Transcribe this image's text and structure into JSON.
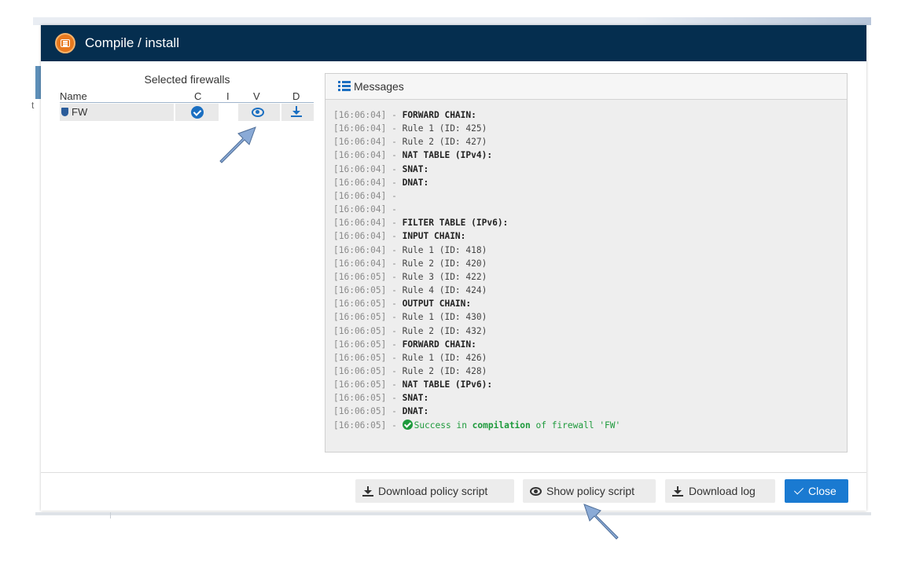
{
  "modal": {
    "title": "Compile / install",
    "header_icon": "compile-icon",
    "header_color": "#052e4f",
    "accent_color": "#1a7ad1"
  },
  "firewalls": {
    "caption": "Selected firewalls",
    "columns": [
      "Name",
      "C",
      "I",
      "V",
      "D"
    ],
    "rows": [
      {
        "name": "FW",
        "icon": "firewall-shield-icon",
        "compiled": "check-circle-icon",
        "installed": "",
        "view": "eye-icon",
        "download": "download-icon"
      }
    ]
  },
  "messages": {
    "title": "Messages",
    "icon": "list-icon",
    "log": [
      {
        "time": "[16:06:04]",
        "text": "FORWARD CHAIN:",
        "bold": true
      },
      {
        "time": "[16:06:04]",
        "text": "Rule 1 (ID: 425)",
        "bold": false
      },
      {
        "time": "[16:06:04]",
        "text": "Rule 2 (ID: 427)",
        "bold": false
      },
      {
        "time": "[16:06:04]",
        "text": "NAT TABLE (IPv4):",
        "bold": true
      },
      {
        "time": "[16:06:04]",
        "text": "SNAT:",
        "bold": true
      },
      {
        "time": "[16:06:04]",
        "text": "DNAT:",
        "bold": true
      },
      {
        "time": "[16:06:04]",
        "text": "",
        "bold": false
      },
      {
        "time": "[16:06:04]",
        "text": "",
        "bold": false
      },
      {
        "time": "[16:06:04]",
        "text": "FILTER TABLE (IPv6):",
        "bold": true
      },
      {
        "time": "[16:06:04]",
        "text": "INPUT CHAIN:",
        "bold": true
      },
      {
        "time": "[16:06:04]",
        "text": "Rule 1 (ID: 418)",
        "bold": false
      },
      {
        "time": "[16:06:04]",
        "text": "Rule 2 (ID: 420)",
        "bold": false
      },
      {
        "time": "[16:06:05]",
        "text": "Rule 3 (ID: 422)",
        "bold": false
      },
      {
        "time": "[16:06:05]",
        "text": "Rule 4 (ID: 424)",
        "bold": false
      },
      {
        "time": "[16:06:05]",
        "text": "OUTPUT CHAIN:",
        "bold": true
      },
      {
        "time": "[16:06:05]",
        "text": "Rule 1 (ID: 430)",
        "bold": false
      },
      {
        "time": "[16:06:05]",
        "text": "Rule 2 (ID: 432)",
        "bold": false
      },
      {
        "time": "[16:06:05]",
        "text": "FORWARD CHAIN:",
        "bold": true
      },
      {
        "time": "[16:06:05]",
        "text": "Rule 1 (ID: 426)",
        "bold": false
      },
      {
        "time": "[16:06:05]",
        "text": "Rule 2 (ID: 428)",
        "bold": false
      },
      {
        "time": "[16:06:05]",
        "text": "NAT TABLE (IPv6):",
        "bold": true
      },
      {
        "time": "[16:06:05]",
        "text": "SNAT:",
        "bold": true
      },
      {
        "time": "[16:06:05]",
        "text": "DNAT:",
        "bold": true
      }
    ],
    "success": {
      "time": "[16:06:05]",
      "prefix": "Success in ",
      "keyword": "compilation",
      "suffix": " of firewall 'FW'",
      "icon": "check-circle-icon",
      "color": "#1e9a3c"
    }
  },
  "footer": {
    "download_policy_label": "Download policy script",
    "show_policy_label": "Show policy script",
    "download_log_label": "Download log",
    "close_label": "Close"
  }
}
